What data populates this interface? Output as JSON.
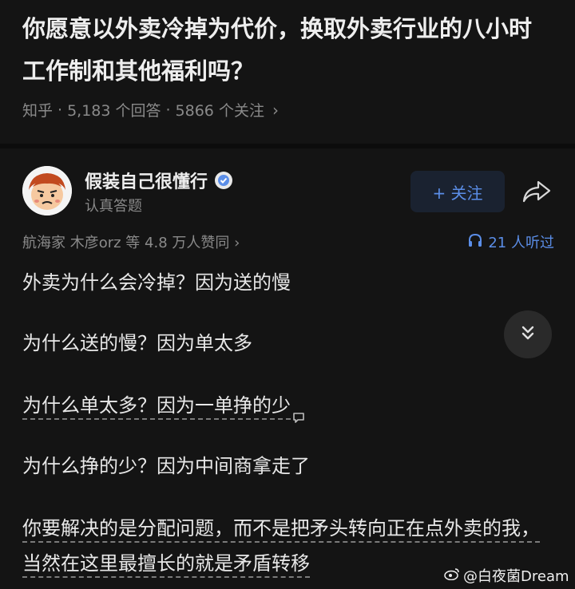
{
  "question": {
    "title": "你愿意以外卖冷掉为代价，换取外卖行业的八小时工作制和其他福利吗？",
    "source": "知乎",
    "answers": "5,183 个回答",
    "followers": "5866 个关注",
    "chevron": "›"
  },
  "answer": {
    "author_name": "假装自己很懂行",
    "author_sub": "认真答题",
    "follow_label": "+ 关注",
    "likes_text": "航海家 木彦orz 等 4.8 万人赞同 ›",
    "listen_text": "21 人听过",
    "paragraphs": [
      "外卖为什么会冷掉？因为送的慢",
      "为什么送的慢？因为单太多",
      "为什么单太多？因为一单挣的少",
      "为什么挣的少？因为中间商拿走了",
      "你要解决的是分配问题，而不是把矛头转向正在点外卖的我，当然在这里最擅长的就是矛盾转移"
    ]
  },
  "watermark": "@白夜菌Dream",
  "colors": {
    "background": "#141414",
    "accent": "#5b8ee8",
    "muted": "#8a8a8a"
  },
  "icons": [
    "verified-badge-icon",
    "share-icon",
    "headphones-icon",
    "double-chevron-down-icon",
    "comment-bubble-icon",
    "weibo-icon"
  ]
}
